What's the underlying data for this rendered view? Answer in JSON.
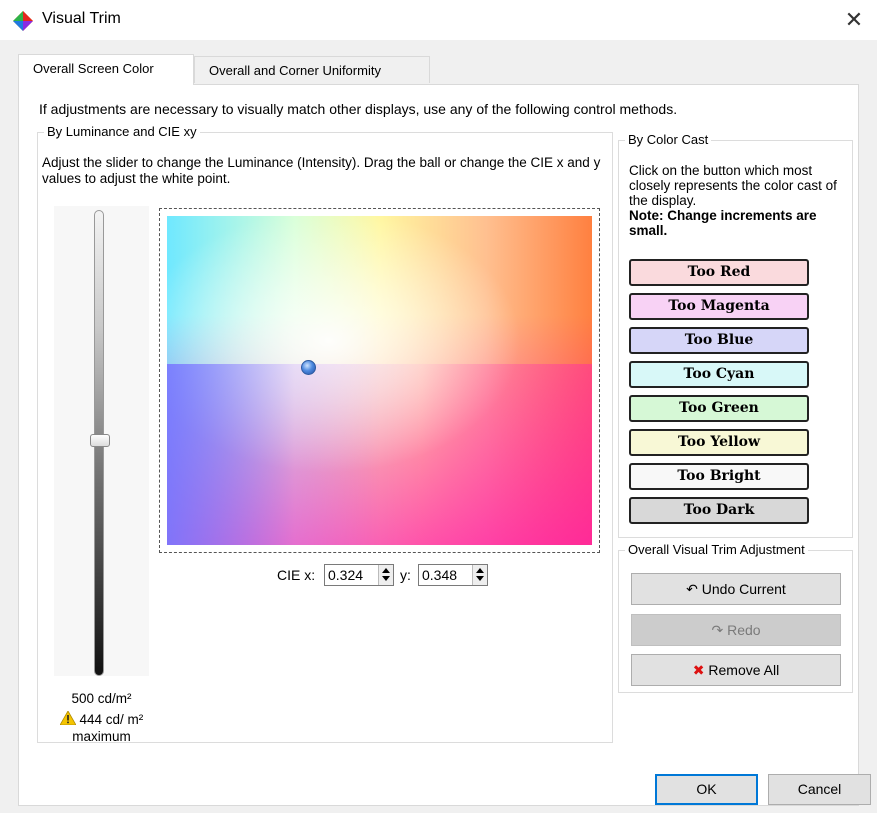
{
  "window": {
    "title": "Visual Trim"
  },
  "tabs": [
    {
      "label": "Overall Screen Color",
      "active": true
    },
    {
      "label": "Overall and Corner Uniformity",
      "active": false
    }
  ],
  "intro": "If adjustments are necessary to visually match other displays, use any of the following control methods.",
  "luminance": {
    "group_title": "By Luminance and CIE xy",
    "description": "Adjust the slider to change the Luminance (Intensity). Drag the ball or change the CIE x and y values to adjust the white point.",
    "value_text": "500 cd/m²",
    "warning_text": "444 cd/ m² maximum",
    "slider_level_fraction": 0.5
  },
  "cie": {
    "x_label": "CIE x:",
    "x_value": "0.324",
    "y_label": "y:",
    "y_value": "0.348"
  },
  "color_cast": {
    "group_title": "By Color Cast",
    "description": "Click on the button which most closely represents the color cast of the display.",
    "note": "Note: Change increments are small.",
    "buttons": [
      {
        "label": "Too Red",
        "color": "#fadadd"
      },
      {
        "label": "Too Magenta",
        "color": "#f8d2f5"
      },
      {
        "label": "Too Blue",
        "color": "#d6d6f8"
      },
      {
        "label": "Too Cyan",
        "color": "#d8f8f8"
      },
      {
        "label": "Too Green",
        "color": "#d6f8d6"
      },
      {
        "label": "Too Yellow",
        "color": "#f8f8d6"
      },
      {
        "label": "Too Bright",
        "color": "#f8f8f8"
      },
      {
        "label": "Too Dark",
        "color": "#d8d8d8"
      }
    ]
  },
  "trim": {
    "group_title": "Overall Visual Trim Adjustment",
    "undo_label": "Undo Current",
    "redo_label": "Redo",
    "remove_label": "Remove All"
  },
  "dialog": {
    "ok_label": "OK",
    "cancel_label": "Cancel"
  }
}
